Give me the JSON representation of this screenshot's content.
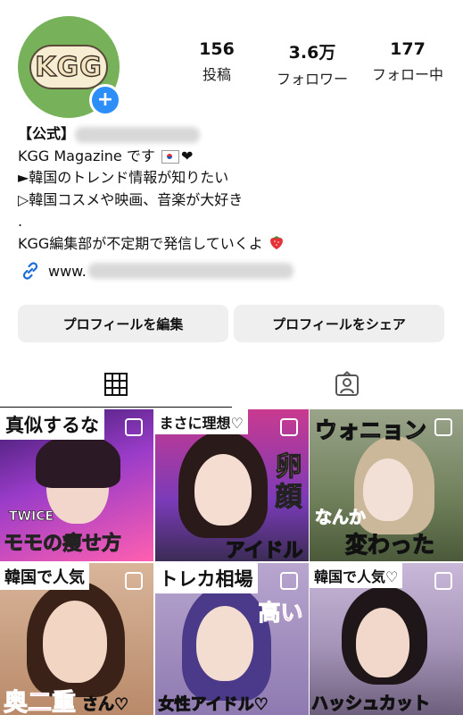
{
  "profile": {
    "avatar_text": "KGG",
    "stats": [
      {
        "value": "156",
        "label": "投稿"
      },
      {
        "value": "3.6万",
        "label": "フォロワー"
      },
      {
        "value": "177",
        "label": "フォロー中"
      }
    ],
    "bio": {
      "official_tag": "【公式】",
      "line1": "KGG Magazine です",
      "line2": "►韓国のトレンド情報が知りたい",
      "line3": "▷韓国コスメや映画、音楽が大好き",
      "line4": ".",
      "line5": "KGG編集部が不定期で発信していくよ"
    },
    "link_text": "www."
  },
  "buttons": {
    "edit_profile": "プロフィールを編集",
    "share_profile": "プロフィールをシェア"
  },
  "posts": [
    {
      "title": "真似するな",
      "sub": "TWICE",
      "caption": "モモの痩せ方"
    },
    {
      "title": "まさに理想♡",
      "side": "卵顔",
      "caption": "アイドル"
    },
    {
      "title": "ウォニョン",
      "caption1": "なんか",
      "caption2": "変わった"
    },
    {
      "title": "韓国で人気",
      "caption": "奥二重",
      "caption_suffix": "さん♡"
    },
    {
      "title": "トレカ相場",
      "sub": "高い",
      "caption": "女性アイドル♡"
    },
    {
      "title": "韓国で人気♡",
      "caption": "ハッシュカット"
    }
  ],
  "colors": {
    "accent_blue": "#2d8ef7",
    "avatar_green": "#77b25a",
    "button_bg": "#efefef",
    "caption_yellow": "#ffd84a",
    "caption_pink": "#ff2f8a"
  }
}
